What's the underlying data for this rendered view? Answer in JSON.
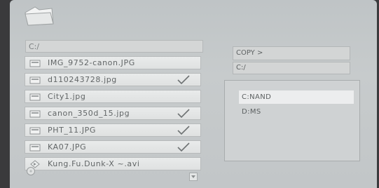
{
  "path": "C:/",
  "files": [
    {
      "name": "IMG_9752-canon.JPG",
      "type": "image",
      "checked": false
    },
    {
      "name": "d110243728.jpg",
      "type": "image",
      "checked": true
    },
    {
      "name": "City1.jpg",
      "type": "image",
      "checked": false
    },
    {
      "name": "canon_350d_15.jpg",
      "type": "image",
      "checked": true
    },
    {
      "name": "PHT_11.JPG",
      "type": "image",
      "checked": true
    },
    {
      "name": "KA07.JPG",
      "type": "image",
      "checked": true
    },
    {
      "name": "Kung.Fu.Dunk-X ~.avi",
      "type": "video",
      "checked": false
    }
  ],
  "copy_panel": {
    "title": "COPY >",
    "destination": "C:/",
    "drives": [
      {
        "label": "C:NAND",
        "selected": true
      },
      {
        "label": "D:MS",
        "selected": false
      }
    ]
  },
  "icons": {
    "top": "folder-icon",
    "file_image": "image-file-icon",
    "file_video": "video-file-icon",
    "check": "checkmark-icon",
    "bottom_left": "disc-icon",
    "bottom_right": "scroll-down-icon"
  },
  "colors": {
    "background": "#c3c7c8",
    "row": "#e4e6e6",
    "text": "#636768"
  }
}
